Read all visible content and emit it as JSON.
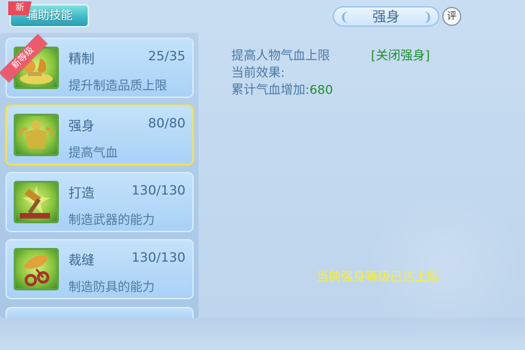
{
  "top_tab": {
    "label": "辅助技能",
    "new_badge": "新"
  },
  "skills": [
    {
      "name": "精制",
      "level": "25/35",
      "desc": "提升制造品质上限",
      "ribbon": "新等级",
      "icon": "refine-icon"
    },
    {
      "name": "强身",
      "level": "80/80",
      "desc": "提高气血",
      "icon": "strength-icon",
      "selected": true
    },
    {
      "name": "打造",
      "level": "130/130",
      "desc": "制造武器的能力",
      "icon": "hammer-icon"
    },
    {
      "name": "裁缝",
      "level": "130/130",
      "desc": "制造防具的能力",
      "icon": "scissors-icon"
    }
  ],
  "detail": {
    "title": "强身",
    "eval_label": "评",
    "line1": "提高人物气血上限",
    "close_link": "[关闭强身]",
    "line2": "当前效果:",
    "line3_label": "累计气血增加:",
    "line3_value": "680",
    "max_message": "当前强身等级已达上限"
  },
  "colors": {
    "accent_green": "#1d8f2e",
    "selected_border": "#f5e25a",
    "message_yellow": "#f7ee3a"
  }
}
